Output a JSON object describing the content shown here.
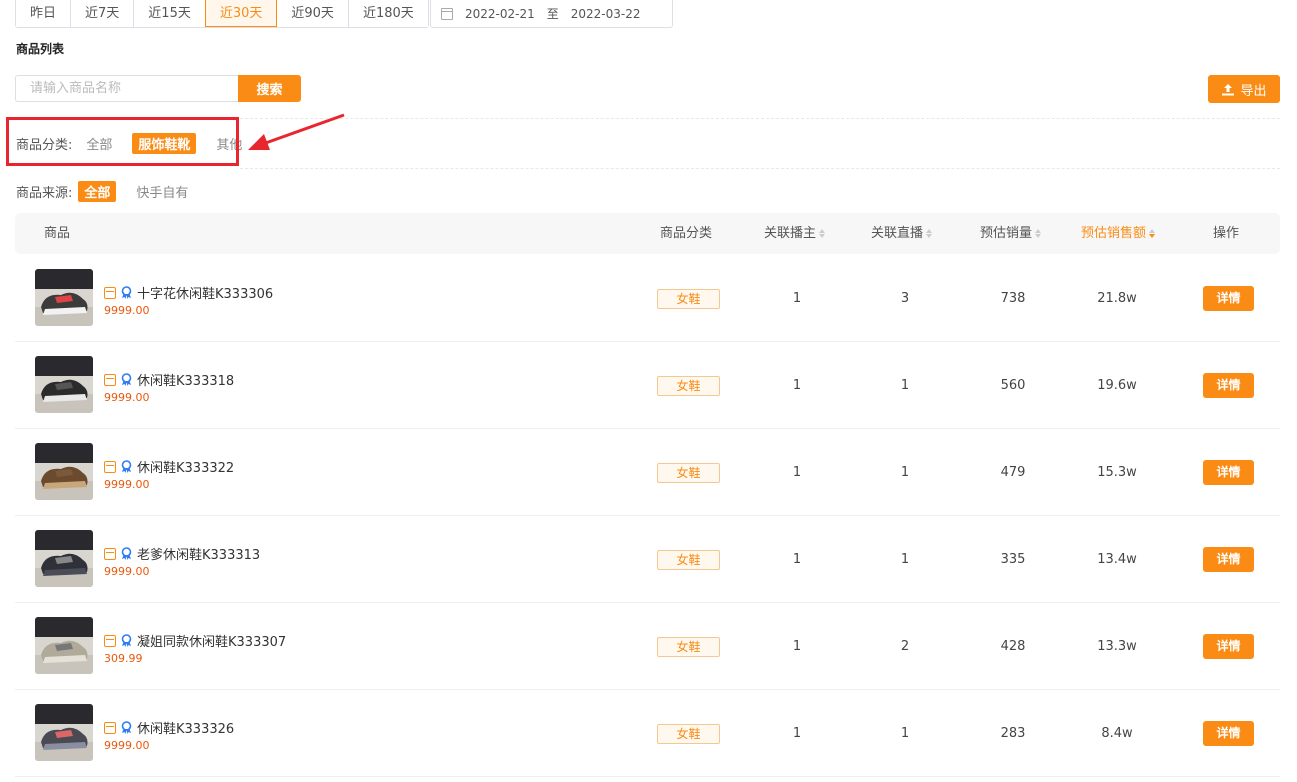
{
  "date_tabs": [
    "昨日",
    "近7天",
    "近15天",
    "近30天",
    "近90天",
    "近180天"
  ],
  "date_tabs_active": "近30天",
  "date_range": {
    "start": "2022-02-21",
    "separator": "至",
    "end": "2022-03-22"
  },
  "section_title": "商品列表",
  "search": {
    "placeholder": "请输入商品名称",
    "value": "",
    "button": "搜索"
  },
  "export_label": "导出",
  "category_filter": {
    "label": "商品分类:",
    "options": [
      "全部",
      "服饰鞋靴",
      "其他"
    ],
    "active": "服饰鞋靴"
  },
  "source_filter": {
    "label": "商品来源:",
    "options": [
      "全部",
      "快手自有"
    ],
    "active": "全部"
  },
  "table": {
    "headers": [
      "商品",
      "商品分类",
      "关联播主",
      "关联直播",
      "预估销量",
      "预估销售额",
      "操作"
    ],
    "rows": [
      {
        "name": "十字花休闲鞋K333306",
        "price": "9999.00",
        "category": "女鞋",
        "anchors": "1",
        "lives": "3",
        "sales": "738",
        "revenue": "21.8w",
        "action": "详情"
      },
      {
        "name": "休闲鞋K333318",
        "price": "9999.00",
        "category": "女鞋",
        "anchors": "1",
        "lives": "1",
        "sales": "560",
        "revenue": "19.6w",
        "action": "详情"
      },
      {
        "name": "休闲鞋K333322",
        "price": "9999.00",
        "category": "女鞋",
        "anchors": "1",
        "lives": "1",
        "sales": "479",
        "revenue": "15.3w",
        "action": "详情"
      },
      {
        "name": "老爹休闲鞋K333313",
        "price": "9999.00",
        "category": "女鞋",
        "anchors": "1",
        "lives": "1",
        "sales": "335",
        "revenue": "13.4w",
        "action": "详情"
      },
      {
        "name": "凝姐同款休闲鞋K333307",
        "price": "309.99",
        "category": "女鞋",
        "anchors": "1",
        "lives": "2",
        "sales": "428",
        "revenue": "13.3w",
        "action": "详情"
      },
      {
        "name": "休闲鞋K333326",
        "price": "9999.00",
        "category": "女鞋",
        "anchors": "1",
        "lives": "1",
        "sales": "283",
        "revenue": "8.4w",
        "action": "详情"
      }
    ]
  },
  "colors": {
    "accent": "#fa8c16",
    "annotation": "#e8262d",
    "price": "#e8590c"
  }
}
